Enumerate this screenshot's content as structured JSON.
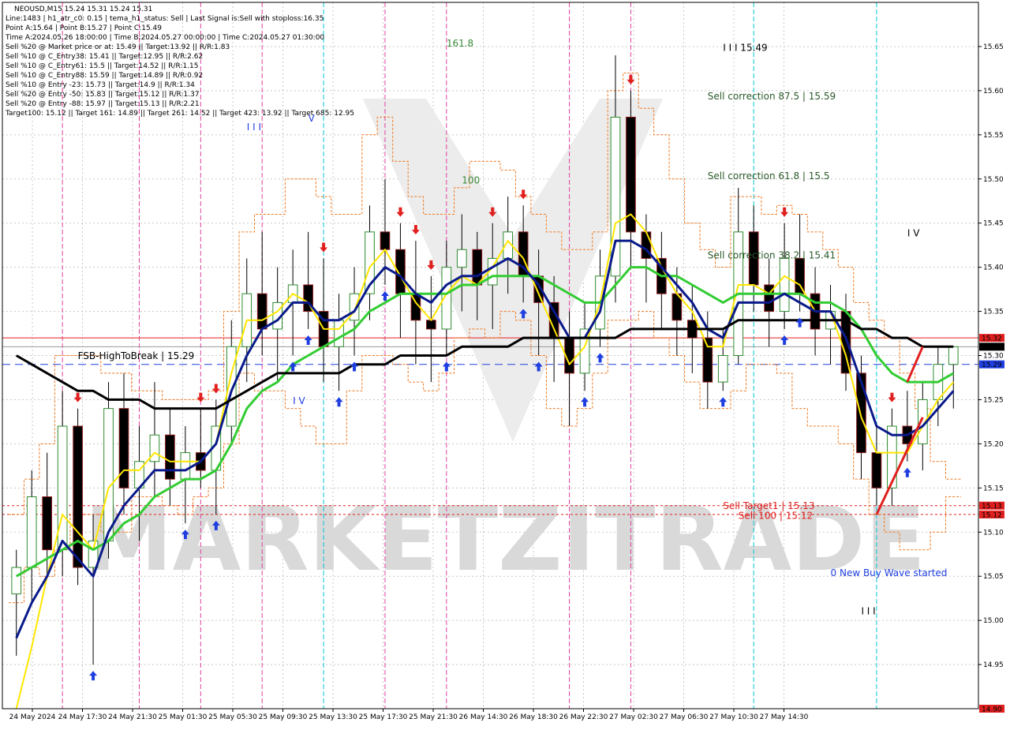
{
  "chart_data": {
    "type": "candlestick",
    "title": "NEOUSD,M15  15.24 15.31 15.24 15.31",
    "info_lines": [
      "Line:1483  |  h1_atr_c0: 0.15  |  tema_h1_status: Sell  |  Last Signal is:Sell with stoploss:16.35",
      "Point A:15.64  |  Point B:15.27  |  Point C:15.49",
      "Time A:2024.05.26 18:00:00  |  Time B:2024.05.27 00:00:00  |  Time C:2024.05.27 01:30:00",
      "Sell %20 @ Market price or at: 15.49  ||  Target:13.92  ||  R/R:1.83",
      "Sell %10 @ C_Entry38: 15.41  ||  Target:12.95  ||  R/R:2.62",
      "Sell %10 @ C_Entry61: 15.5  ||  Target:14.52  ||  R/R:1.15",
      "Sell %10 @ C_Entry88: 15.59  ||  Target:14.89  ||  R/R:0.92",
      "Sell %10 @ Entry -23: 15.73  ||  Target:14.9  ||  R/R:1.34",
      "Sell %20 @ Entry -50: 15.83  ||  Target:15.12  ||  R/R:1.37",
      "Sell %20 @ Entry -88: 15.97  ||  Target:15.13  ||  R/R:2.21",
      "Target100: 15.12  ||  Target 161: 14.89  ||  Target 261: 14.52  ||  Target 423: 13.92  ||  Target 685: 12.95"
    ],
    "y_ticks": [
      "15.65",
      "15.60",
      "15.55",
      "15.50",
      "15.45",
      "15.40",
      "15.35",
      "15.30",
      "15.25",
      "15.20",
      "15.15",
      "15.10",
      "15.05",
      "15.00",
      "14.95"
    ],
    "ylim": [
      14.9,
      15.7
    ],
    "x_ticks": [
      "24 May 2024",
      "24 May 17:30",
      "24 May 21:30",
      "25 May 01:30",
      "25 May 05:30",
      "25 May 09:30",
      "25 May 13:30",
      "25 May 17:30",
      "25 May 21:30",
      "26 May 14:30",
      "26 May 18:30",
      "26 May 22:30",
      "27 May 02:30",
      "27 May 06:30",
      "27 May 10:30",
      "27 May 14:30"
    ],
    "price_tags": [
      {
        "label": "15.32",
        "value": 15.32,
        "color": "#e0201f"
      },
      {
        "label": "15.31",
        "value": 15.31,
        "color": "#000000"
      },
      {
        "label": "15.29",
        "value": 15.29,
        "color": "#1f3ee0"
      },
      {
        "label": "15.13",
        "value": 15.13,
        "color": "#e0201f"
      },
      {
        "label": "15.12",
        "value": 15.12,
        "color": "#e0201f"
      },
      {
        "label": "14.90",
        "value": 14.9,
        "color": "#e0201f"
      }
    ],
    "horizontal_lines": [
      {
        "value": 15.32,
        "color": "#e0201f",
        "style": "solid"
      },
      {
        "value": 15.31,
        "color": "#9a9a9a",
        "style": "solid"
      },
      {
        "value": 15.29,
        "color": "#1f3ee0",
        "style": "dashed"
      },
      {
        "value": 15.13,
        "color": "#e0201f",
        "style": "dotted"
      },
      {
        "value": 15.12,
        "color": "#e0201f",
        "style": "dotted"
      }
    ],
    "annotations": [
      {
        "text": "161.8",
        "color": "#3a8a3a",
        "x_index": 28,
        "y": 15.65
      },
      {
        "text": "I I I 15.49",
        "color": "#000000",
        "x_index": 46,
        "y": 15.645
      },
      {
        "text": "Sell correction 87.5 | 15.59",
        "color": "#2a5a2a",
        "x_index": 45,
        "y": 15.59
      },
      {
        "text": "100",
        "color": "#3a8a3a",
        "x_index": 29,
        "y": 15.495
      },
      {
        "text": "Sell correction 61.8 | 15.5",
        "color": "#2a5a2a",
        "x_index": 45,
        "y": 15.5
      },
      {
        "text": "Sell correction 38.2 | 15.41",
        "color": "#2a5a2a",
        "x_index": 45,
        "y": 15.41
      },
      {
        "text": "I I I",
        "color": "#1f3ee0",
        "x_index": 15,
        "y": 15.555
      },
      {
        "text": "V",
        "color": "#1f3ee0",
        "x_index": 19,
        "y": 15.565
      },
      {
        "text": "I V",
        "color": "#000000",
        "x_index": 58,
        "y": 15.435
      },
      {
        "text": "I V",
        "color": "#1f3ee0",
        "x_index": 18,
        "y": 15.245
      },
      {
        "text": "FSB-HighToBreak  |  15.29",
        "color": "#000000",
        "x_index": 4,
        "y": 15.296
      },
      {
        "text": "Sell Target1  |  15.13",
        "color": "#e0201f",
        "x_index": 46,
        "y": 15.126
      },
      {
        "text": "Sell 100  |  15.12",
        "color": "#e0201f",
        "x_index": 47,
        "y": 15.115
      },
      {
        "text": "0 New Buy Wave started",
        "color": "#1f3ee0",
        "x_index": 53,
        "y": 15.05
      },
      {
        "text": "I I I",
        "color": "#000000",
        "x_index": 55,
        "y": 15.007
      }
    ],
    "ohlc": [
      [
        15.03,
        15.08,
        14.96,
        15.06
      ],
      [
        15.06,
        15.17,
        15.02,
        15.14
      ],
      [
        15.14,
        15.19,
        15.05,
        15.08
      ],
      [
        15.08,
        15.26,
        15.05,
        15.22
      ],
      [
        15.22,
        15.24,
        15.04,
        15.06
      ],
      [
        15.06,
        15.12,
        14.95,
        15.09
      ],
      [
        15.09,
        15.27,
        15.07,
        15.24
      ],
      [
        15.24,
        15.28,
        15.12,
        15.15
      ],
      [
        15.15,
        15.22,
        15.09,
        15.18
      ],
      [
        15.18,
        15.27,
        15.14,
        15.21
      ],
      [
        15.21,
        15.24,
        15.13,
        15.16
      ],
      [
        15.16,
        15.22,
        15.11,
        15.19
      ],
      [
        15.19,
        15.24,
        15.15,
        15.17
      ],
      [
        15.17,
        15.25,
        15.12,
        15.22
      ],
      [
        15.22,
        15.34,
        15.2,
        15.31
      ],
      [
        15.31,
        15.41,
        15.27,
        15.37
      ],
      [
        15.37,
        15.44,
        15.3,
        15.33
      ],
      [
        15.33,
        15.4,
        15.27,
        15.36
      ],
      [
        15.36,
        15.42,
        15.3,
        15.38
      ],
      [
        15.38,
        15.44,
        15.33,
        15.35
      ],
      [
        15.35,
        15.41,
        15.27,
        15.31
      ],
      [
        15.31,
        15.37,
        15.26,
        15.34
      ],
      [
        15.34,
        15.4,
        15.3,
        15.37
      ],
      [
        15.37,
        15.47,
        15.34,
        15.44
      ],
      [
        15.44,
        15.5,
        15.38,
        15.42
      ],
      [
        15.42,
        15.45,
        15.32,
        15.37
      ],
      [
        15.37,
        15.43,
        15.29,
        15.34
      ],
      [
        15.34,
        15.39,
        15.27,
        15.33
      ],
      [
        15.33,
        15.43,
        15.3,
        15.4
      ],
      [
        15.4,
        15.46,
        15.35,
        15.42
      ],
      [
        15.42,
        15.44,
        15.34,
        15.38
      ],
      [
        15.38,
        15.45,
        15.33,
        15.41
      ],
      [
        15.41,
        15.48,
        15.37,
        15.44
      ],
      [
        15.44,
        15.47,
        15.36,
        15.39
      ],
      [
        15.39,
        15.42,
        15.3,
        15.36
      ],
      [
        15.36,
        15.39,
        15.27,
        15.32
      ],
      [
        15.32,
        15.35,
        15.22,
        15.28
      ],
      [
        15.28,
        15.36,
        15.26,
        15.33
      ],
      [
        15.33,
        15.42,
        15.31,
        15.39
      ],
      [
        15.39,
        15.64,
        15.36,
        15.57
      ],
      [
        15.57,
        15.6,
        15.4,
        15.44
      ],
      [
        15.44,
        15.46,
        15.36,
        15.41
      ],
      [
        15.41,
        15.44,
        15.33,
        15.37
      ],
      [
        15.37,
        15.4,
        15.3,
        15.34
      ],
      [
        15.34,
        15.38,
        15.28,
        15.32
      ],
      [
        15.32,
        15.35,
        15.24,
        15.27
      ],
      [
        15.27,
        15.33,
        15.26,
        15.3
      ],
      [
        15.3,
        15.49,
        15.29,
        15.44
      ],
      [
        15.44,
        15.47,
        15.35,
        15.38
      ],
      [
        15.38,
        15.41,
        15.31,
        15.35
      ],
      [
        15.35,
        15.45,
        15.33,
        15.41
      ],
      [
        15.41,
        15.46,
        15.35,
        15.37
      ],
      [
        15.37,
        15.4,
        15.3,
        15.33
      ],
      [
        15.33,
        15.38,
        15.29,
        15.35
      ],
      [
        15.35,
        15.37,
        15.26,
        15.28
      ],
      [
        15.28,
        15.3,
        15.16,
        15.19
      ],
      [
        15.19,
        15.22,
        15.13,
        15.15
      ],
      [
        15.15,
        15.24,
        15.13,
        15.22
      ],
      [
        15.22,
        15.26,
        15.18,
        15.2
      ],
      [
        15.2,
        15.27,
        15.17,
        15.25
      ],
      [
        15.25,
        15.31,
        15.22,
        15.29
      ],
      [
        15.29,
        15.31,
        15.24,
        15.31
      ]
    ],
    "ma_black": [
      15.3,
      15.29,
      15.28,
      15.27,
      15.26,
      15.26,
      15.25,
      15.25,
      15.25,
      15.24,
      15.24,
      15.24,
      15.24,
      15.24,
      15.25,
      15.26,
      15.27,
      15.28,
      15.28,
      15.28,
      15.28,
      15.28,
      15.29,
      15.29,
      15.29,
      15.3,
      15.3,
      15.3,
      15.3,
      15.31,
      15.31,
      15.31,
      15.31,
      15.32,
      15.32,
      15.32,
      15.32,
      15.32,
      15.32,
      15.32,
      15.33,
      15.33,
      15.33,
      15.33,
      15.33,
      15.33,
      15.33,
      15.34,
      15.34,
      15.34,
      15.34,
      15.34,
      15.34,
      15.34,
      15.34,
      15.33,
      15.33,
      15.32,
      15.32,
      15.31,
      15.31,
      15.31
    ],
    "ma_green": [
      15.05,
      15.06,
      15.07,
      15.08,
      15.09,
      15.08,
      15.09,
      15.11,
      15.12,
      15.14,
      15.15,
      15.16,
      15.16,
      15.17,
      15.2,
      15.24,
      15.26,
      15.27,
      15.29,
      15.3,
      15.31,
      15.32,
      15.33,
      15.35,
      15.36,
      15.37,
      15.37,
      15.37,
      15.37,
      15.38,
      15.38,
      15.39,
      15.39,
      15.39,
      15.39,
      15.38,
      15.37,
      15.36,
      15.36,
      15.38,
      15.4,
      15.4,
      15.39,
      15.39,
      15.38,
      15.37,
      15.36,
      15.37,
      15.37,
      15.37,
      15.37,
      15.37,
      15.36,
      15.36,
      15.35,
      15.33,
      15.3,
      15.28,
      15.27,
      15.27,
      15.27,
      15.28
    ],
    "ma_navy": [
      14.98,
      15.02,
      15.05,
      15.09,
      15.07,
      15.05,
      15.1,
      15.13,
      15.15,
      15.17,
      15.17,
      15.17,
      15.18,
      15.2,
      15.26,
      15.3,
      15.33,
      15.34,
      15.36,
      15.36,
      15.34,
      15.34,
      15.35,
      15.38,
      15.4,
      15.39,
      15.37,
      15.36,
      15.38,
      15.39,
      15.39,
      15.4,
      15.41,
      15.4,
      15.38,
      15.35,
      15.32,
      15.32,
      15.35,
      15.43,
      15.43,
      15.42,
      15.4,
      15.38,
      15.36,
      15.33,
      15.32,
      15.36,
      15.36,
      15.36,
      15.37,
      15.36,
      15.35,
      15.35,
      15.32,
      15.27,
      15.22,
      15.21,
      15.21,
      15.22,
      15.24,
      15.26
    ],
    "ma_yellow": [
      14.9,
      14.97,
      15.05,
      15.12,
      15.1,
      15.08,
      15.15,
      15.17,
      15.17,
      15.19,
      15.18,
      15.18,
      15.18,
      15.2,
      15.28,
      15.34,
      15.34,
      15.35,
      15.37,
      15.36,
      15.33,
      15.33,
      15.35,
      15.4,
      15.42,
      15.39,
      15.36,
      15.34,
      15.37,
      15.39,
      15.38,
      15.4,
      15.43,
      15.41,
      15.37,
      15.33,
      15.29,
      15.31,
      15.36,
      15.45,
      15.46,
      15.44,
      15.4,
      15.37,
      15.35,
      15.31,
      15.31,
      15.38,
      15.38,
      15.37,
      15.39,
      15.38,
      15.35,
      15.35,
      15.3,
      15.23,
      15.19,
      15.19,
      15.19,
      15.22,
      15.25,
      15.27
    ],
    "channel": [
      [
        15.12,
        15.02
      ],
      [
        15.16,
        15.06
      ],
      [
        15.2,
        15.05
      ],
      [
        15.3,
        15.08
      ],
      [
        15.3,
        15.12
      ],
      [
        15.3,
        15.12
      ],
      [
        15.28,
        15.1
      ],
      [
        15.28,
        15.1
      ],
      [
        15.26,
        15.14
      ],
      [
        15.26,
        15.14
      ],
      [
        15.25,
        15.13
      ],
      [
        15.25,
        15.12
      ],
      [
        15.25,
        15.14
      ],
      [
        15.26,
        15.15
      ],
      [
        15.35,
        15.2
      ],
      [
        15.44,
        15.28
      ],
      [
        15.46,
        15.26
      ],
      [
        15.46,
        15.26
      ],
      [
        15.5,
        15.24
      ],
      [
        15.5,
        15.22
      ],
      [
        15.48,
        15.2
      ],
      [
        15.46,
        15.2
      ],
      [
        15.46,
        15.26
      ],
      [
        15.55,
        15.3
      ],
      [
        15.57,
        15.3
      ],
      [
        15.52,
        15.29
      ],
      [
        15.48,
        15.27
      ],
      [
        15.46,
        15.26
      ],
      [
        15.46,
        15.28
      ],
      [
        15.49,
        15.32
      ],
      [
        15.52,
        15.33
      ],
      [
        15.52,
        15.32
      ],
      [
        15.51,
        15.35
      ],
      [
        15.48,
        15.34
      ],
      [
        15.46,
        15.3
      ],
      [
        15.44,
        15.24
      ],
      [
        15.42,
        15.22
      ],
      [
        15.42,
        15.24
      ],
      [
        15.44,
        15.28
      ],
      [
        15.6,
        15.34
      ],
      [
        15.62,
        15.34
      ],
      [
        15.58,
        15.35
      ],
      [
        15.55,
        15.32
      ],
      [
        15.5,
        15.3
      ],
      [
        15.45,
        15.27
      ],
      [
        15.42,
        15.24
      ],
      [
        15.4,
        15.24
      ],
      [
        15.48,
        15.26
      ],
      [
        15.48,
        15.29
      ],
      [
        15.46,
        15.29
      ],
      [
        15.47,
        15.28
      ],
      [
        15.46,
        15.24
      ],
      [
        15.44,
        15.22
      ],
      [
        15.42,
        15.22
      ],
      [
        15.4,
        15.2
      ],
      [
        15.36,
        15.16
      ],
      [
        15.34,
        15.12
      ],
      [
        15.32,
        15.1
      ],
      [
        15.28,
        15.08
      ],
      [
        15.24,
        15.08
      ],
      [
        15.18,
        15.1
      ],
      [
        15.16,
        15.14
      ]
    ],
    "arrows_up": [
      5,
      11,
      13,
      18,
      19,
      21,
      22,
      24,
      28,
      33,
      34,
      37,
      38,
      46,
      50,
      51,
      58
    ],
    "arrows_down": [
      4,
      12,
      13,
      20,
      25,
      26,
      27,
      31,
      33,
      40,
      50,
      57
    ],
    "vlines": [
      {
        "x_index": 3,
        "color": "#e040a0"
      },
      {
        "x_index": 8,
        "color": "#e040a0"
      },
      {
        "x_index": 12,
        "color": "#e040a0"
      },
      {
        "x_index": 16,
        "color": "#e040a0"
      },
      {
        "x_index": 20,
        "color": "#00c8d8"
      },
      {
        "x_index": 24,
        "color": "#e040a0"
      },
      {
        "x_index": 28,
        "color": "#e040a0"
      },
      {
        "x_index": 36,
        "color": "#e040a0"
      },
      {
        "x_index": 40,
        "color": "#e040a0"
      },
      {
        "x_index": 48,
        "color": "#00c8d8"
      },
      {
        "x_index": 56,
        "color": "#00c8d8"
      }
    ],
    "grid": true,
    "watermark": "MARKETZITRADE"
  }
}
